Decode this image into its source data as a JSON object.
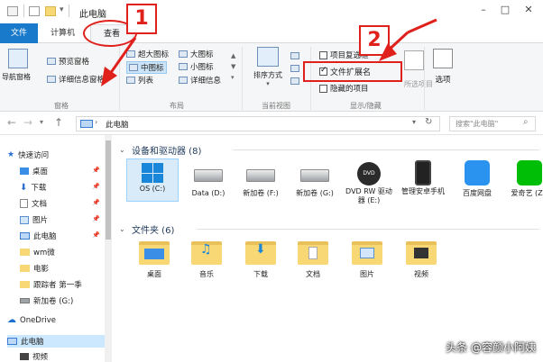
{
  "window": {
    "title": "此电脑"
  },
  "tabs": {
    "file": "文件",
    "computer": "计算机",
    "view": "查看"
  },
  "ribbon": {
    "pane": {
      "navigation_pane": "导航窗格",
      "preview_pane": "预览窗格",
      "details_pane": "详细信息窗格",
      "group": "窗格"
    },
    "layout": {
      "options": [
        "超大图标",
        "大图标",
        "中图标",
        "小图标",
        "列表",
        "详细信息"
      ],
      "selected": "中图标",
      "group": "布局"
    },
    "current_view": {
      "sort_by": "排序方式",
      "group": "当前视图"
    },
    "show_hide": {
      "item_checkboxes": "项目复选框",
      "file_extensions": "文件扩展名",
      "hidden_items": "隐藏的项目",
      "hide_selected": "所选项目",
      "options": "选项",
      "group": "显示/隐藏"
    }
  },
  "address": {
    "path": "此电脑",
    "search_placeholder": "搜索\"此电脑\""
  },
  "nav": {
    "quick_access": "快速访问",
    "items": [
      {
        "label": "桌面",
        "pinned": true
      },
      {
        "label": "下载",
        "pinned": true
      },
      {
        "label": "文档",
        "pinned": true
      },
      {
        "label": "图片",
        "pinned": true
      },
      {
        "label": "此电脑",
        "pinned": true
      },
      {
        "label": "wm微",
        "pinned": false
      },
      {
        "label": "电影",
        "pinned": false
      },
      {
        "label": "跟踪者 第一季",
        "pinned": false
      },
      {
        "label": "新加卷 (G:)",
        "pinned": false
      }
    ],
    "onedrive": "OneDrive",
    "this_pc": "此电脑",
    "videos": "视频"
  },
  "devices": {
    "title": "设备和驱动器 (8)",
    "items": [
      "OS (C:)",
      "Data (D:)",
      "新加卷 (F:)",
      "新加卷 (G:)",
      "DVD RW 驱动器 (E:)",
      "管理安卓手机",
      "百度网盘",
      "爱奇艺 (Z:)"
    ]
  },
  "folders": {
    "title": "文件夹 (6)",
    "items": [
      "桌面",
      "音乐",
      "下载",
      "文档",
      "图片",
      "视频"
    ]
  },
  "annotations": {
    "step1": "1",
    "step2": "2"
  },
  "watermark": "头条 @容颜小阿姨",
  "colors": {
    "accent": "#1979ca",
    "annotation": "#e0201b"
  }
}
